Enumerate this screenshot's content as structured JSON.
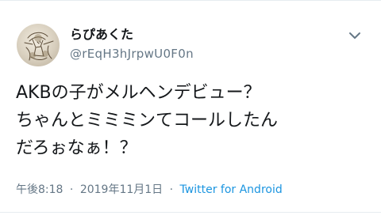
{
  "tweet": {
    "author": {
      "display_name": "らぴあくた",
      "handle": "@rEqH3hJrpwU0F0n",
      "avatar_icon": "avatar-sketch-illustration"
    },
    "menu_icon": "chevron-down-icon",
    "text_lines": [
      "AKBの子がメルヘンデビュー？",
      "ちゃんとミミミンてコールしたん",
      "だろぉなぁ！？"
    ],
    "meta": {
      "time": "午後8:18",
      "separator1": "·",
      "date": "2019年11月1日",
      "separator2": "·",
      "source": "Twitter for Android"
    },
    "colors": {
      "text": "#14171a",
      "secondary": "#657786",
      "link": "#1b95e0",
      "divider": "#e6ecf0"
    }
  }
}
